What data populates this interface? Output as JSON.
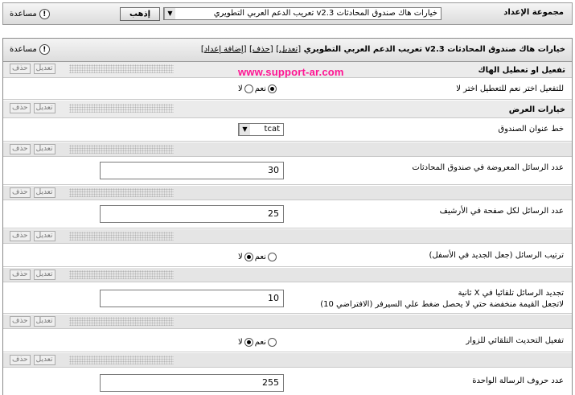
{
  "top_bar": {
    "help_label": "مساعدة",
    "group_label": "مجموعة الإعداد",
    "selected_group": "خيارات هاك صندوق المحادثات v2.3 تعريب الدعم العربي التطويري",
    "go_button": "إذهب"
  },
  "panel": {
    "title": "خيارات هاك صندوق المحادثات v2.3 تعريب الدعم العربي التطويري",
    "edit_link": "تعديل",
    "delete_link": "حذف",
    "add_setting_link": "إضافة إعداد",
    "help_label": "مساعدة",
    "watermark": "www.support-ar.com"
  },
  "control_links": {
    "edit": "تعديل",
    "delete": "حذف"
  },
  "radio_labels": {
    "yes": "نعم",
    "no": "لا"
  },
  "sections": [
    {
      "title": "تفعيل او تعطيل الهاك"
    },
    {
      "title": "خيارات العرض"
    }
  ],
  "settings": {
    "enable_hack": {
      "label": "للتفعيل اختر نعم للتعطيل اختر لا",
      "selected": "yes"
    },
    "box_title_font": {
      "label": "خط عنوان الصندوق",
      "value": "tcat"
    },
    "messages_in_box": {
      "label": "عدد الرسائل المعروضة في صندوق المحادثات",
      "value": "30"
    },
    "messages_per_archive_page": {
      "label": "عدد الرسائل لكل صفحة في الأرشيف",
      "value": "25"
    },
    "message_order": {
      "label": "ترتيب الرسائل (جعل الجديد في الأسفل)",
      "selected": "no"
    },
    "auto_refresh": {
      "label_line1": "تجديد الرسائل تلقائيا في X ثانية",
      "label_line2": "لاتجعل القيمة منخفضة حتي لا يحصل ضغط علي السيرفر (الافتراضي 10)",
      "value": "10"
    },
    "guest_auto_refresh": {
      "label": "تفعيل التحديث التلقائي للزوار",
      "selected": "no"
    },
    "max_message_chars": {
      "label": "عدد حروف الرسالة الواحدة",
      "value": "255"
    }
  }
}
